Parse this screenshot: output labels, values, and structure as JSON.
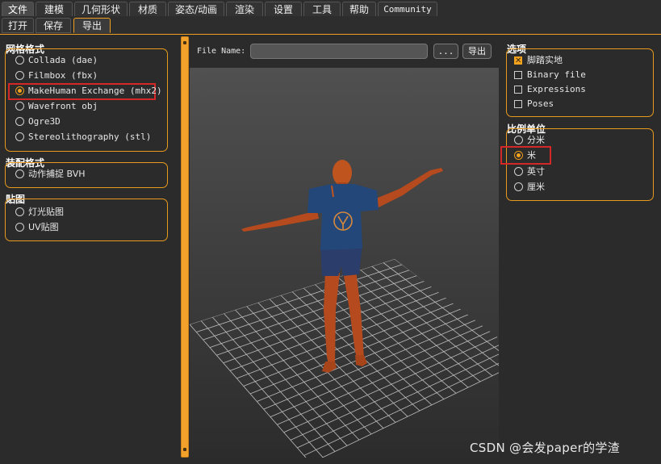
{
  "top_tabs": [
    "文件",
    "建模",
    "几何形状",
    "材质",
    "姿态/动画",
    "渲染",
    "设置",
    "工具",
    "帮助",
    "Community"
  ],
  "sub_tabs": [
    "打开",
    "保存",
    "导出"
  ],
  "mesh_format": {
    "title": "网格格式",
    "options": [
      "Collada (dae)",
      "Filmbox (fbx)",
      "MakeHuman Exchange (mhx2)",
      "Wavefront obj",
      "Ogre3D",
      "Stereolithography (stl)"
    ],
    "selected": "MakeHuman Exchange (mhx2)"
  },
  "rig_format": {
    "title": "装配格式",
    "options": [
      "动作捕捉 BVH"
    ]
  },
  "maps": {
    "title": "贴图",
    "options": [
      "灯光贴图",
      "UV贴图"
    ]
  },
  "file": {
    "label": "File Name:",
    "value": "",
    "browse_label": "...",
    "export_label": "导出"
  },
  "options": {
    "title": "选项",
    "items": [
      {
        "label": "脚踏实地",
        "checked": true
      },
      {
        "label": "Binary file",
        "checked": false
      },
      {
        "label": "Expressions",
        "checked": false
      },
      {
        "label": "Poses",
        "checked": false
      }
    ]
  },
  "scale": {
    "title": "比例单位",
    "options": [
      "分米",
      "米",
      "英寸",
      "厘米"
    ],
    "selected": "米"
  },
  "watermark": "CSDN @会发paper的学渣",
  "colors": {
    "accent": "#f0a020",
    "highlight": "#d42828"
  }
}
